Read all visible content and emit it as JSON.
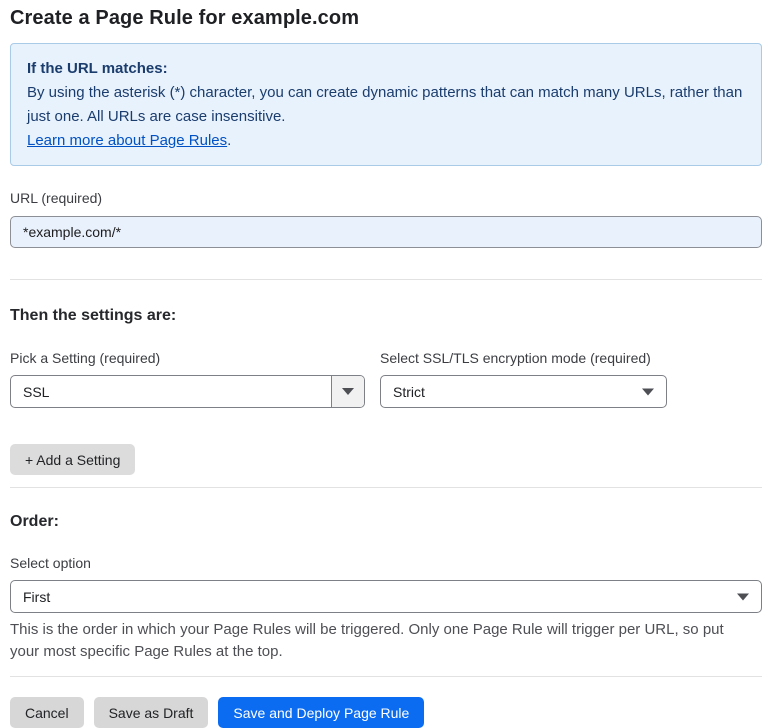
{
  "page": {
    "title": "Create a Page Rule for example.com"
  },
  "info_box": {
    "heading": "If the URL matches:",
    "body": "By using the asterisk (*) character, you can create dynamic patterns that can match many URLs, rather than just one. All URLs are case insensitive.",
    "link_label": "Learn more about Page Rules",
    "link_suffix": "."
  },
  "url_field": {
    "label": "URL (required)",
    "value": "*example.com/*"
  },
  "settings_section": {
    "heading": "Then the settings are:",
    "setting_select": {
      "label": "Pick a Setting (required)",
      "value": "SSL"
    },
    "mode_select": {
      "label": "Select SSL/TLS encryption mode (required)",
      "value": "Strict"
    },
    "add_setting_label": "+ Add a Setting"
  },
  "order_section": {
    "heading": "Order:",
    "select_label": "Select option",
    "select_value": "First",
    "help_text": "This is the order in which your Page Rules will be triggered. Only one Page Rule will trigger per URL, so put your most specific Page Rules at the top."
  },
  "footer": {
    "cancel_label": "Cancel",
    "save_draft_label": "Save as Draft",
    "save_deploy_label": "Save and Deploy Page Rule"
  },
  "colors": {
    "accent_blue": "#0b6cf2",
    "link_blue": "#0051c3",
    "info_background": "#e8f2fc",
    "info_border": "#a9cbe8",
    "info_text": "#1b3d6e",
    "input_background": "#e9f1fc"
  }
}
